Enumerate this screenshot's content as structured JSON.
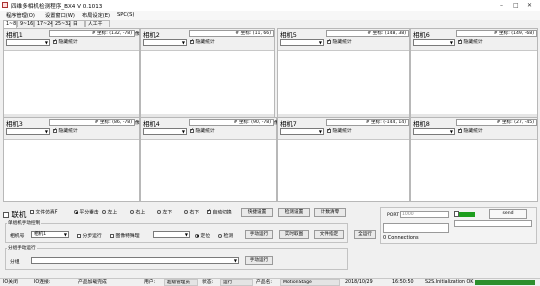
{
  "window": {
    "title": "四维多相机检测程序_BX4  V 0.1013",
    "minimize": "–",
    "maximize": "□",
    "close": "✕"
  },
  "menu": [
    "程序管理(O)",
    "设置窗口(W)",
    "布局设定(E)",
    "SPC(S)"
  ],
  "tabs": [
    "1~8",
    "9~16",
    "17~24",
    "25~32",
    "日志",
    "人工干涉"
  ],
  "cameras": [
    {
      "name": "相机1",
      "coord": "# 坐标: (132, -78)",
      "hide_label": "隐藏统计",
      "hide_checked": true,
      "side": "像"
    },
    {
      "name": "相机2",
      "coord": "# 坐标: (11, 66)",
      "hide_label": "隐藏统计",
      "hide_checked": true,
      "side": ""
    },
    {
      "name": "相机5",
      "coord": "# 坐标: (148, 38)",
      "hide_label": "隐藏统计",
      "hide_checked": true,
      "side": ""
    },
    {
      "name": "相机6",
      "coord": "# 坐标: (149, -68)",
      "hide_label": "隐藏统计",
      "hide_checked": true,
      "side": ""
    },
    {
      "name": "相机3",
      "coord": "# 坐标: (86, -78)",
      "hide_label": "隐藏统计",
      "hide_checked": true,
      "side": "像"
    },
    {
      "name": "相机4",
      "coord": "# 坐标: (90, -78)",
      "hide_label": "隐藏统计",
      "hide_checked": true,
      "side": "像"
    },
    {
      "name": "相机7",
      "coord": "# 坐标: (-144, 14)",
      "hide_label": "隐藏统计",
      "hide_checked": true,
      "side": ""
    },
    {
      "name": "相机8",
      "coord": "# 坐标: (27, -45)",
      "hide_label": "隐藏统计",
      "hide_checked": true,
      "side": ""
    }
  ],
  "controls": {
    "online_label": "联机",
    "row1": {
      "file_sim": "文件仿真F",
      "mode_options": [
        "平分垂击",
        "左上",
        "右上",
        "左下",
        "右下"
      ],
      "auto_switch": "自动切换",
      "buttons": [
        "快捷设置",
        "检测设置",
        "计数清零"
      ]
    },
    "single_group_title": "单组机手动控制",
    "camera_no_label": "相机号",
    "camera_select": "相机1",
    "step_run": "分步运行",
    "image_special": "图像特殊理",
    "position_label": "定位",
    "detect_label": "检测",
    "manual_run": "手动运行",
    "realtime_image": "实时取图",
    "file_specify": "文件指定",
    "full_run": "全运行",
    "group_title": "分组手动运行",
    "group_label": "分组",
    "manual_run2": "手动运行"
  },
  "connection": {
    "port_label": "PORT",
    "port_value": "1000",
    "cmd_placeholder": "",
    "status_text": "0 Connections",
    "send_label": "send"
  },
  "status_bar": {
    "io_off": "IO关闭",
    "io_status": "IO连接:",
    "product_loaded": "产品加载完成",
    "user_label": "用户:",
    "user_value": "超级管理员",
    "state_label": "状态:",
    "state_value": "运行",
    "product_label": "产品名:",
    "product_value": "MotionStage",
    "date": "2018/10/29",
    "time": "16:50:50",
    "init_msg": "S2S.Initialization OK",
    "progress_label": ""
  },
  "colors": {
    "accent_green": "#1e9e1e",
    "progress_green": "#2d8f2d"
  }
}
